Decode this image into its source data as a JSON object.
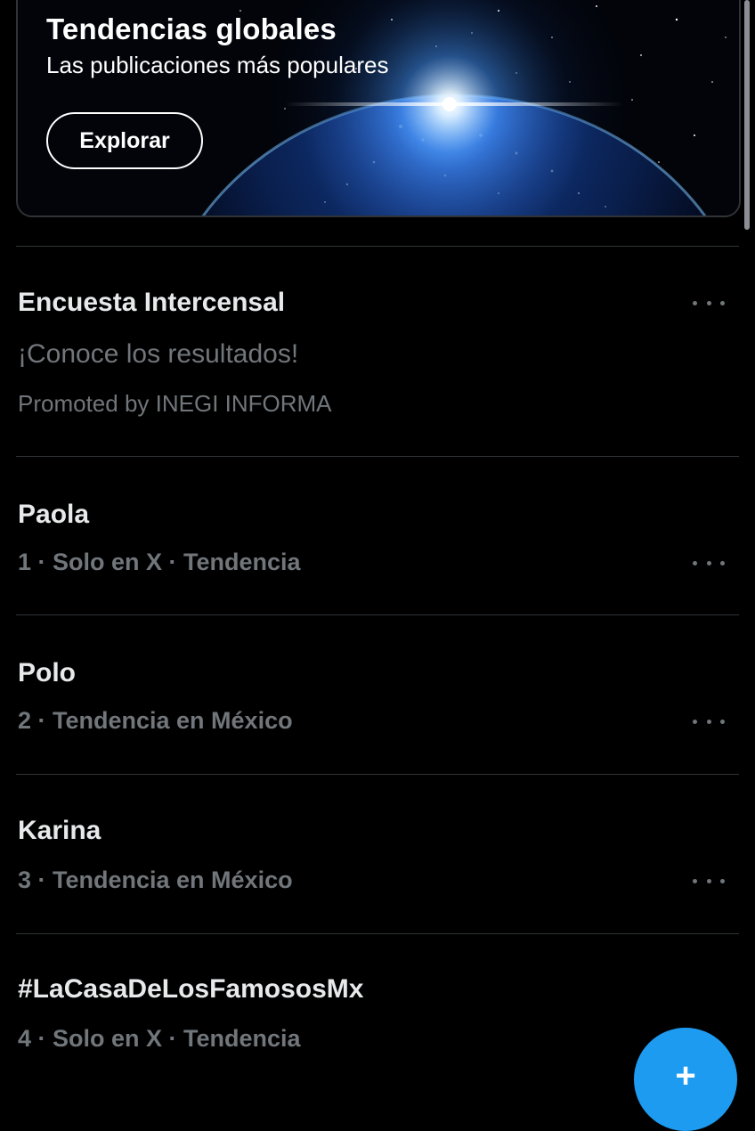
{
  "banner": {
    "title": "Tendencias globales",
    "subtitle": "Las publicaciones más populares",
    "button_label": "Explorar"
  },
  "promoted": {
    "title": "Encuesta Intercensal",
    "description": "¡Conoce los resultados!",
    "promoted_by": "Promoted by INEGI INFORMA"
  },
  "trends": [
    {
      "name": "Paola",
      "meta": "1 · Solo en X · Tendencia"
    },
    {
      "name": "Polo",
      "meta": "2 · Tendencia en México"
    },
    {
      "name": "Karina",
      "meta": "3 · Tendencia en México"
    },
    {
      "name": "#LaCasaDeLosFamososMx",
      "meta": "4 · Solo en X · Tendencia"
    }
  ],
  "fab": {
    "icon": "plus-icon"
  },
  "colors": {
    "background": "#000000",
    "primary_text": "#e7e9ea",
    "secondary_text": "#71767b",
    "divider": "#2f3336",
    "accent": "#1d9bf0"
  }
}
